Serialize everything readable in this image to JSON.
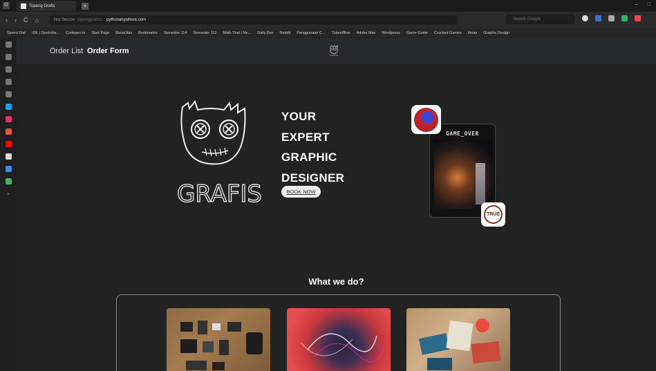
{
  "browser": {
    "tab_title": "Topeng Grafis",
    "new_tab": "+",
    "address": {
      "security": "Not Secure",
      "subdomain": "topenggrafis1.",
      "domain": "pythonanywhere.com"
    },
    "search_placeholder": "Search Google",
    "bookmarks": [
      "Speed Dial",
      "IDE | Geeksfor...",
      "Codepen.io",
      "Start Page",
      "BacaUtas",
      "Bookmarks",
      "Semester 114",
      "Semester 113",
      "Math That I Ne...",
      "Daily.Dev",
      "Reddit",
      "Penggunaan C...",
      "Tubeoffline",
      "Adobe Max",
      "Wordpress",
      "Game Guide",
      "Cracked Games",
      "Ideas",
      "Graphic Design"
    ],
    "colors": {
      "sidebar_twitter": "#1da1f2",
      "sidebar_instagram": "#e1306c",
      "sidebar_youtube": "#ff0000"
    }
  },
  "site": {
    "nav": {
      "order_list": "Order List",
      "order_form": "Order Form"
    },
    "hero": {
      "line1": "YOUR",
      "line2": "EXPERT",
      "line3": "GRAPHIC",
      "line4": "DESIGNER",
      "cta": "BOOK NOW",
      "logo_text": "GRAFIS"
    },
    "poster": {
      "title": "GAME_OVER",
      "badge_text": "TRUE"
    },
    "services": {
      "title": "What we do?"
    }
  }
}
